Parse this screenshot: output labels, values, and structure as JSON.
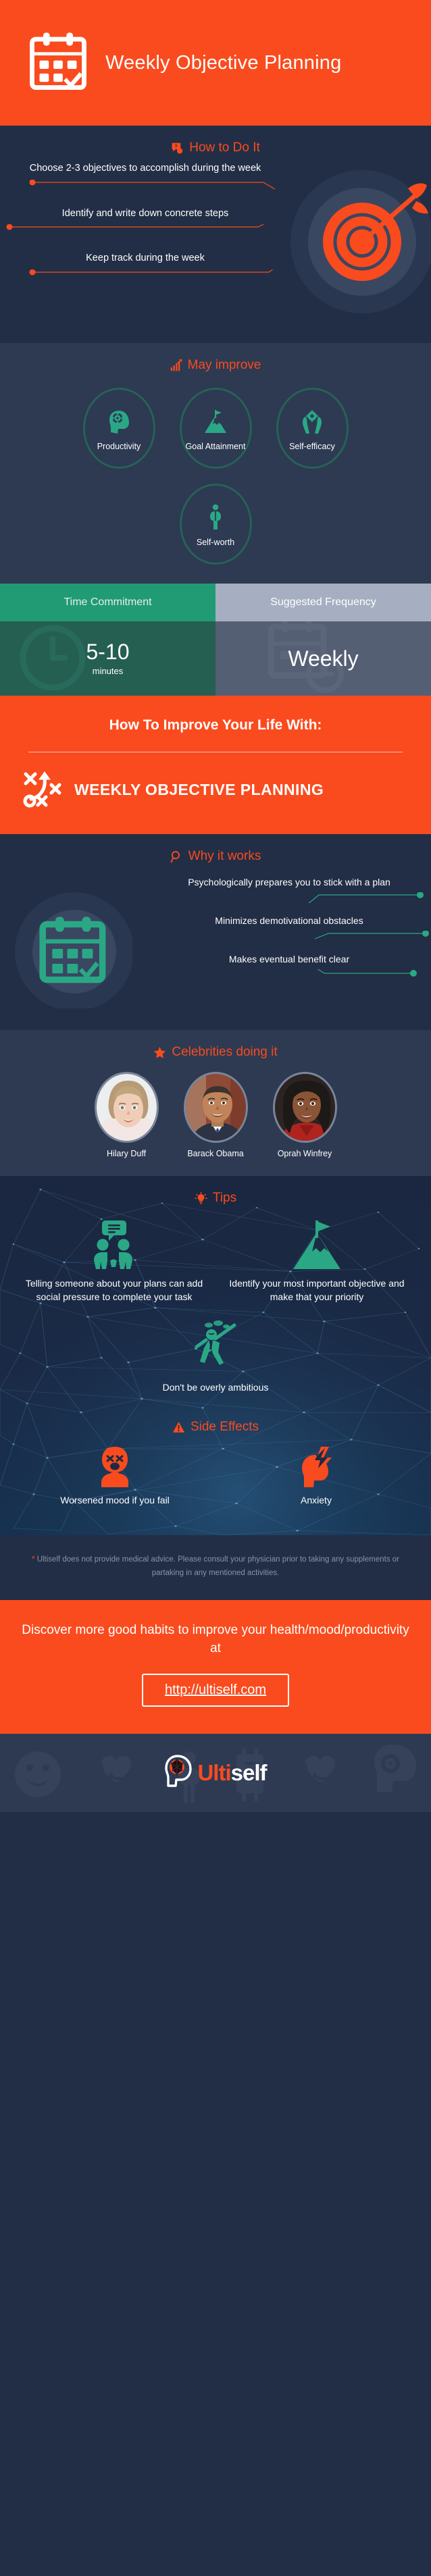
{
  "colors": {
    "orange": "#fa4b1e",
    "navy_dark": "#222e45",
    "navy_mid": "#2d3a52",
    "teal": "#2aa886",
    "teal_dark": "#256257",
    "green_header": "#219b74",
    "gray_header": "#a5afc1",
    "network_bg": "#1d2a44"
  },
  "header": {
    "title": "Weekly Objective Planning",
    "icon": "calendar-check-icon"
  },
  "how_to_do_it": {
    "heading": "How to Do It",
    "heading_icon": "question-bubble-icon",
    "side_icon": "target-dart-icon",
    "steps": [
      "Choose 2-3 objectives to accomplish during the week",
      "Identify and write down concrete steps",
      "Keep track during the week"
    ]
  },
  "may_improve": {
    "heading": "May improve",
    "heading_icon": "bar-chart-arrow-icon",
    "items": [
      {
        "label": "Productivity",
        "icon": "head-gear-icon"
      },
      {
        "label": "Goal Attainment",
        "icon": "mountain-flag-icon"
      },
      {
        "label": "Self-efficacy",
        "icon": "hands-gear-icon"
      },
      {
        "label": "Self-worth",
        "icon": "standing-person-icon"
      }
    ]
  },
  "stats": {
    "columns": [
      {
        "header": "Time Commitment",
        "value": "5-10",
        "unit": "minutes",
        "bg_icon": "clock-icon"
      },
      {
        "header": "Suggested Frequency",
        "value": "Weekly",
        "unit": "",
        "bg_icon": "calendar-clock-icon"
      }
    ]
  },
  "banner": {
    "top_line": "How To Improve Your Life With:",
    "name": "WEEKLY OBJECTIVE PLANNING",
    "icon": "strategy-play-icon"
  },
  "why_it_works": {
    "heading": "Why it works",
    "heading_icon": "magnifier-icon",
    "side_icon": "calendar-check-icon",
    "reasons": [
      "Psychologically prepares you to stick with a plan",
      "Minimizes demotivational obstacles",
      "Makes eventual benefit clear"
    ]
  },
  "celebrities": {
    "heading": "Celebrities doing it",
    "heading_icon": "star-icon",
    "people": [
      {
        "name": "Hilary Duff",
        "photo": "portrait-hilary-duff"
      },
      {
        "name": "Barack Obama",
        "photo": "portrait-barack-obama"
      },
      {
        "name": "Oprah Winfrey",
        "photo": "portrait-oprah-winfrey"
      }
    ]
  },
  "tips": {
    "heading": "Tips",
    "heading_icon": "lightbulb-icon",
    "items": [
      {
        "text": "Telling someone about your plans can add social pressure to complete your task",
        "icon": "two-people-talking-icon"
      },
      {
        "text": "Identify your most important objective and make that your priority",
        "icon": "mountain-flag-icon"
      },
      {
        "text": "Don't be overly ambitious",
        "icon": "running-person-icon"
      }
    ]
  },
  "side_effects": {
    "heading": "Side Effects",
    "heading_icon": "warning-triangle-icon",
    "items": [
      {
        "text": "Worsened mood if you fail",
        "icon": "angry-face-icon"
      },
      {
        "text": "Anxiety",
        "icon": "head-lightning-icon"
      }
    ]
  },
  "disclaimer": {
    "star": "*",
    "text": "Ultiself does not provide medical advice. Please consult your physician prior to taking any supplements or partaking in any mentioned activities."
  },
  "cta": {
    "text": "Discover more good habits to improve your health/mood/productivity at",
    "url": "http://ultiself.com"
  },
  "footer": {
    "brand_first": "Ulti",
    "brand_second": "self",
    "logo_icon": "brain-head-logo-icon"
  }
}
